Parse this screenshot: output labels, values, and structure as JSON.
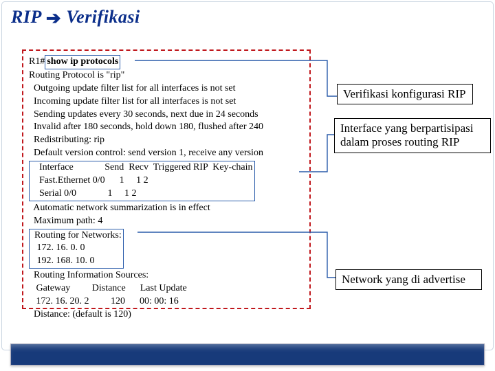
{
  "title": {
    "part1": "RIP",
    "part2": "Verifikasi"
  },
  "terminal": {
    "prompt": "R1#",
    "command": "show ip protocols",
    "lines_pre": [
      "Routing Protocol is \"rip\"",
      "  Outgoing update filter list for all interfaces is not set",
      "  Incoming update filter list for all interfaces is not set",
      "  Sending updates every 30 seconds, next due in 24 seconds",
      "  Invalid after 180 seconds, hold down 180, flushed after 240",
      "  Redistributing: rip",
      "  Default version control: send version 1, receive any version"
    ],
    "iface_block": [
      "    Interface             Send  Recv  Triggered RIP  Key-chain",
      "    Fast.Ethernet 0/0      1     1 2",
      "    Serial 0/0             1     1 2"
    ],
    "lines_mid": [
      "  Automatic network summarization is in effect",
      "  Maximum path: 4"
    ],
    "net_block": [
      "  Routing for Networks:",
      "   172. 16. 0. 0",
      "   192. 168. 10. 0"
    ],
    "lines_post": [
      "  Routing Information Sources:",
      "   Gateway         Distance      Last Update",
      "   172. 16. 20. 2         120      00: 00: 16",
      "  Distance: (default is 120)"
    ]
  },
  "annotations": {
    "a1": "Verifikasi konfigurasi RIP",
    "a2": "Interface yang berpartisipasi dalam proses routing RIP",
    "a3": "Network yang di advertise"
  }
}
